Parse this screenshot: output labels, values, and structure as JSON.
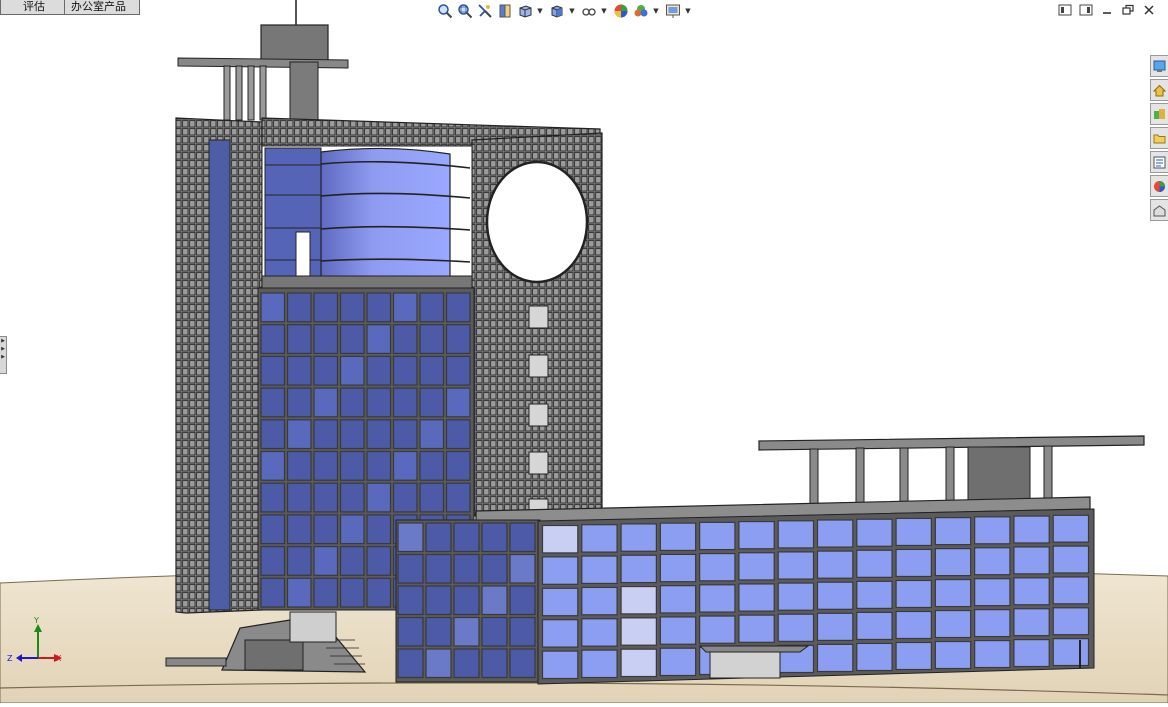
{
  "document_tabs": [
    {
      "label": "评估"
    },
    {
      "label": "办公室产品"
    }
  ],
  "heads_up_toolbar": [
    {
      "icon": "zoom-to-fit-icon"
    },
    {
      "icon": "zoom-to-area-icon"
    },
    {
      "icon": "previous-view-icon"
    },
    {
      "icon": "section-view-icon"
    },
    {
      "icon": "view-orientation-icon",
      "dropdown": true
    },
    {
      "icon": "display-style-icon",
      "dropdown": true
    },
    {
      "icon": "hide-show-items-icon",
      "dropdown": true
    },
    {
      "icon": "edit-appearance-icon"
    },
    {
      "icon": "apply-scene-icon",
      "dropdown": true
    },
    {
      "icon": "view-settings-icon",
      "dropdown": true
    }
  ],
  "window_controls": [
    "tile-horizontal-icon",
    "tile-vertical-icon",
    "minimize-icon",
    "restore-icon",
    "close-icon"
  ],
  "task_pane": [
    "resources-icon",
    "design-library-icon",
    "file-explorer-icon",
    "view-palette-icon",
    "appearances-icon",
    "custom-properties-icon",
    "tab-icon"
  ],
  "triad": {
    "x": "X",
    "y": "Y",
    "z": "Z"
  },
  "colors": {
    "glass_light": "#8c9ef2",
    "glass_dark": "#4c5aa8",
    "mullion": "#3a3a3a",
    "concrete": "#7a7a7a",
    "floor": "#e8dcc4",
    "cylinder": "#7f8de8"
  }
}
